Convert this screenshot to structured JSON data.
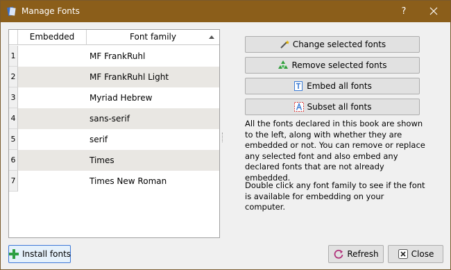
{
  "window": {
    "title": "Manage Fonts",
    "help": "?"
  },
  "table": {
    "columns": {
      "embedded": "Embedded",
      "family": "Font family"
    },
    "rows": [
      {
        "num": "1",
        "family": "MF FrankRuhl"
      },
      {
        "num": "2",
        "family": "MF FrankRuhl Light"
      },
      {
        "num": "3",
        "family": "Myriad Hebrew"
      },
      {
        "num": "4",
        "family": "sans-serif"
      },
      {
        "num": "5",
        "family": "serif"
      },
      {
        "num": "6",
        "family": "Times"
      },
      {
        "num": "7",
        "family": "Times New Roman"
      }
    ]
  },
  "actions": {
    "change": "Change selected fonts",
    "remove": "Remove selected fonts",
    "embed": "Embed all fonts",
    "subset": "Subset all fonts"
  },
  "description": {
    "p1": "All the fonts declared in this book are shown to the left, along with whether they are embedded or not. You can remove or replace any selected font and also embed any declared fonts that are not already embedded.",
    "p2": "Double click any font family to see if the font is available for embedding on your computer."
  },
  "footer": {
    "install": "Install fonts",
    "refresh": "Refresh",
    "close": "Close"
  },
  "colors": {
    "titlebar": "#8b5e1a",
    "alt_row": "#e9e7e3",
    "focus_border": "#3c78d8"
  }
}
